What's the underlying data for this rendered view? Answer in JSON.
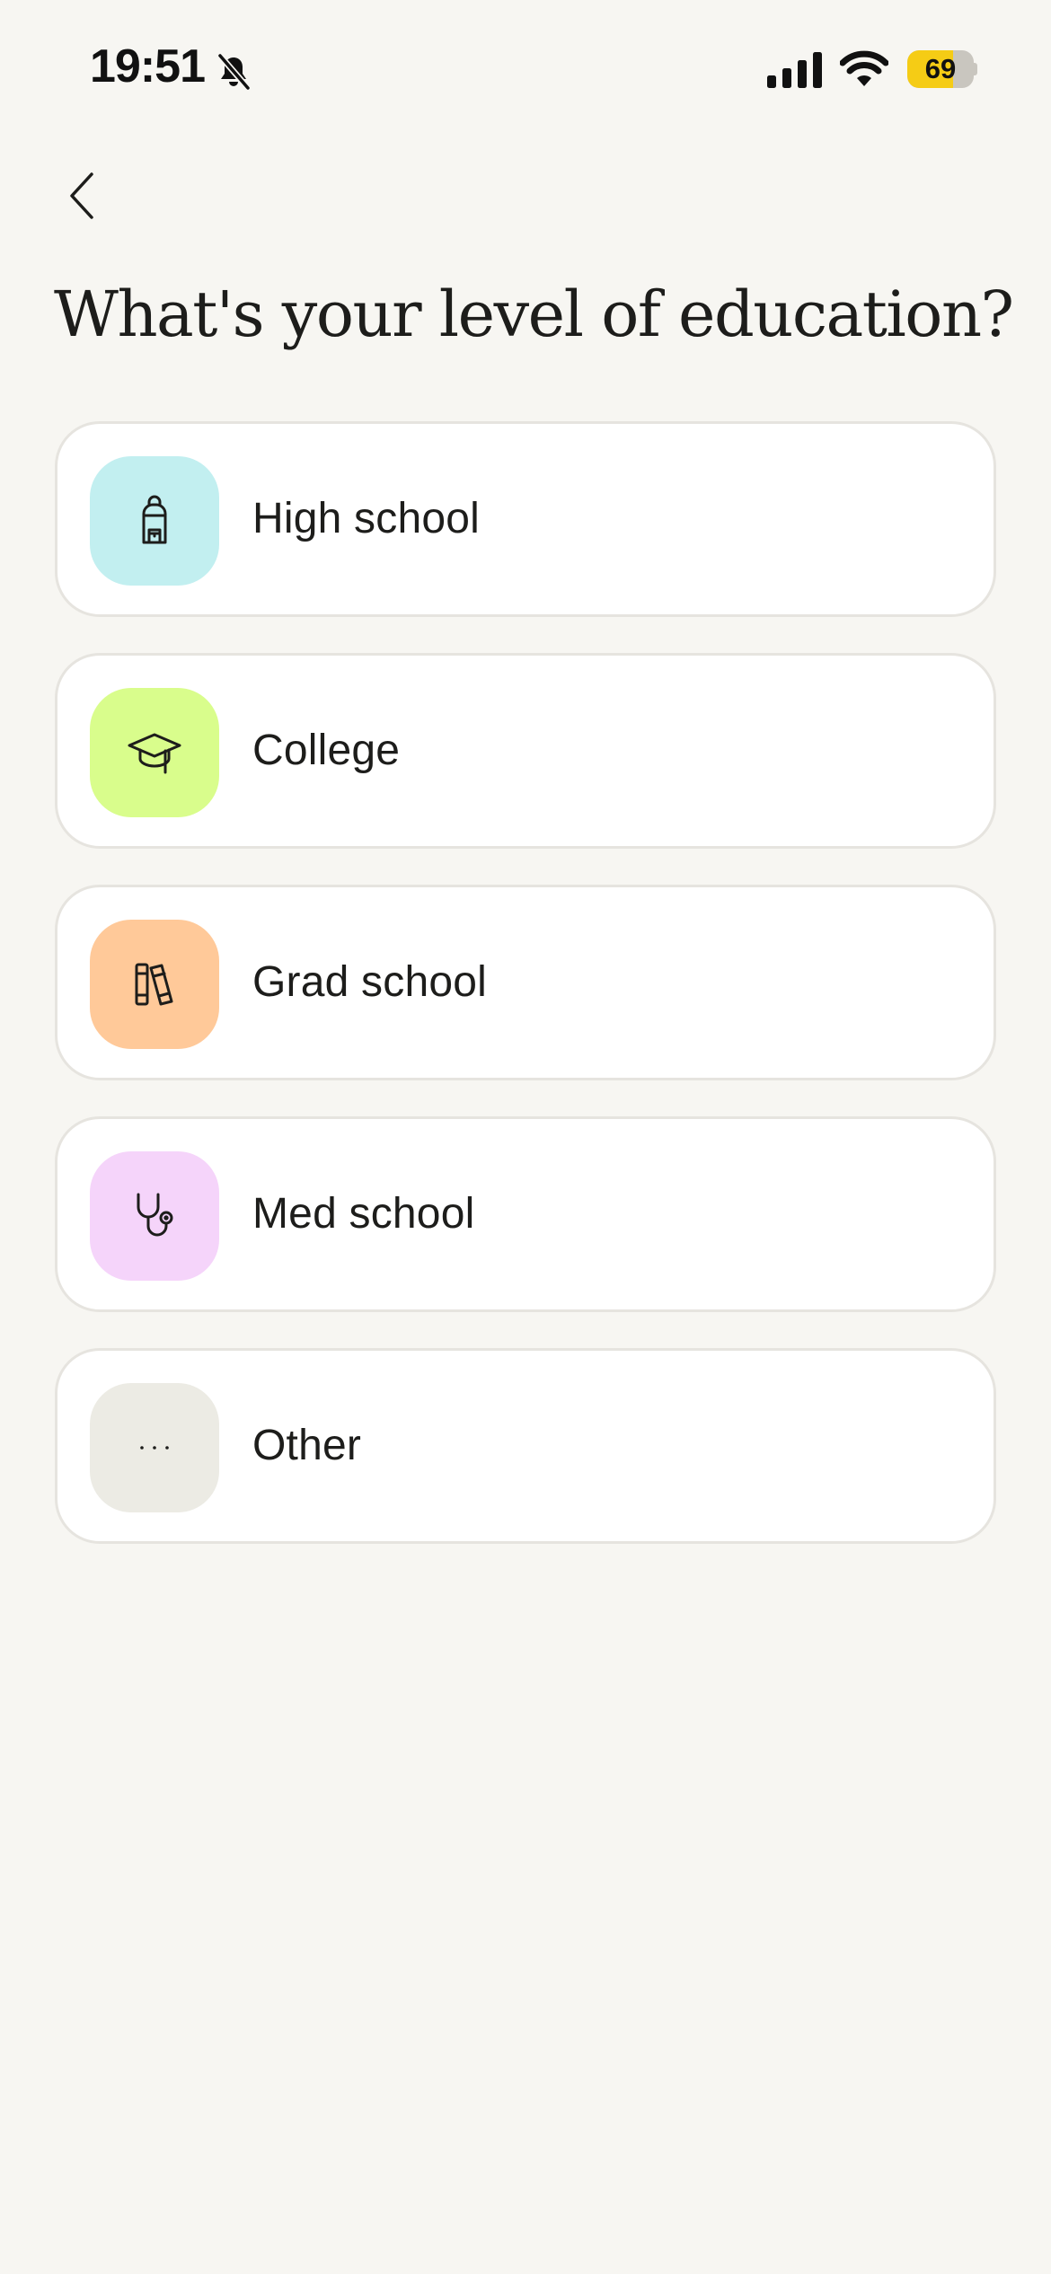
{
  "status_bar": {
    "time": "19:51",
    "battery_percent": "69",
    "battery_level": 0.69,
    "icons": [
      "bell-muted-icon",
      "signal-icon",
      "wifi-icon",
      "battery-icon"
    ]
  },
  "nav": {
    "back_icon": "chevron-left-icon"
  },
  "page": {
    "title": "What's your level of education?"
  },
  "options": [
    {
      "label": "High school",
      "icon": "backpack-icon",
      "color": "#c2eff0"
    },
    {
      "label": "College",
      "icon": "graduation-cap-icon",
      "color": "#d9fd8c"
    },
    {
      "label": "Grad school",
      "icon": "books-icon",
      "color": "#ffc999"
    },
    {
      "label": "Med school",
      "icon": "stethoscope-icon",
      "color": "#f5d4fa"
    },
    {
      "label": "Other",
      "icon": "more-horizontal-icon",
      "color": "#ecebe4"
    }
  ]
}
